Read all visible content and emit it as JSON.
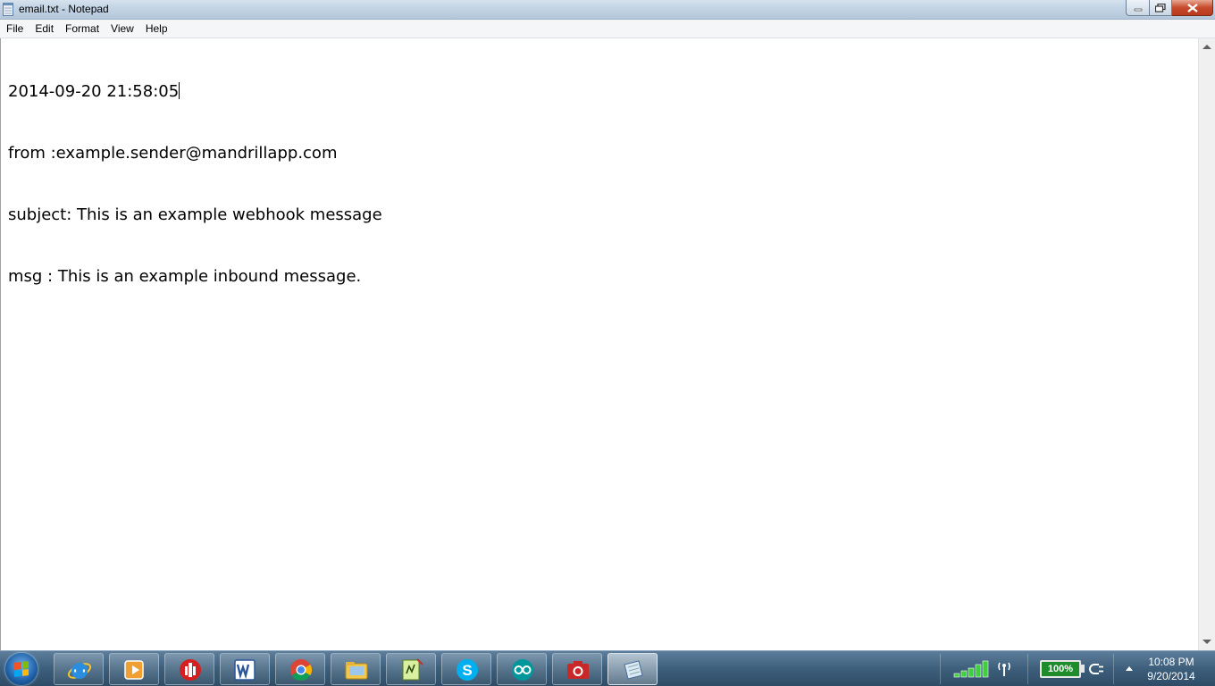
{
  "window": {
    "title": "email.txt - Notepad",
    "controls": {
      "minimize_icon": "minimize-icon",
      "maximize_icon": "restore-icon",
      "close_icon": "close-icon"
    }
  },
  "menu": [
    "File",
    "Edit",
    "Format",
    "View",
    "Help"
  ],
  "document": {
    "lines": [
      "2014-09-20 21:58:05",
      "from :example.sender@mandrillapp.com",
      "subject: This is an example webhook message",
      "msg : This is an example inbound message."
    ]
  },
  "taskbar": {
    "start_icon": "windows-start-icon",
    "apps": [
      {
        "icon": "internet-explorer-icon"
      },
      {
        "icon": "media-player-icon"
      },
      {
        "icon": "red-app-icon"
      },
      {
        "icon": "word-icon"
      },
      {
        "icon": "chrome-icon"
      },
      {
        "icon": "file-explorer-icon"
      },
      {
        "icon": "notepadpp-icon"
      },
      {
        "icon": "skype-icon"
      },
      {
        "icon": "arduino-icon"
      },
      {
        "icon": "camera-app-icon"
      },
      {
        "icon": "notepad-icon",
        "active": true
      }
    ],
    "tray": {
      "battery": "100%",
      "time": "10:08 PM",
      "date": "9/20/2014"
    }
  },
  "colors": {
    "titlebar": "#c2d3e4",
    "taskbar": "#3d5f7c",
    "close": "#c74a2c"
  }
}
